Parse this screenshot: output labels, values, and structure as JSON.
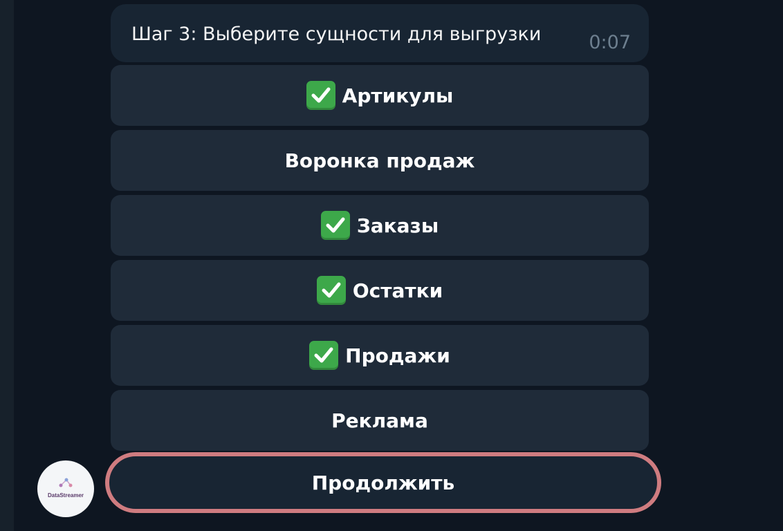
{
  "message": {
    "text": "Шаг 3: Выберите сущности для выгрузки",
    "time": "0:07"
  },
  "buttons": [
    {
      "label": "Артикулы",
      "checked": true
    },
    {
      "label": "Воронка продаж",
      "checked": false
    },
    {
      "label": "Заказы",
      "checked": true
    },
    {
      "label": "Остатки",
      "checked": true
    },
    {
      "label": "Продажи",
      "checked": true
    },
    {
      "label": "Реклама",
      "checked": false
    }
  ],
  "continue_label": "Продолжить",
  "bot": {
    "avatar_text": "DataStreamer",
    "icon": "molecule-icon"
  },
  "colors": {
    "background": "#0e1621",
    "bubble": "#182533",
    "button": "#1f2b39",
    "check": "#3da84a",
    "highlight": "#cf7c80"
  },
  "icons": {
    "checked": "check-mark-button-icon"
  }
}
